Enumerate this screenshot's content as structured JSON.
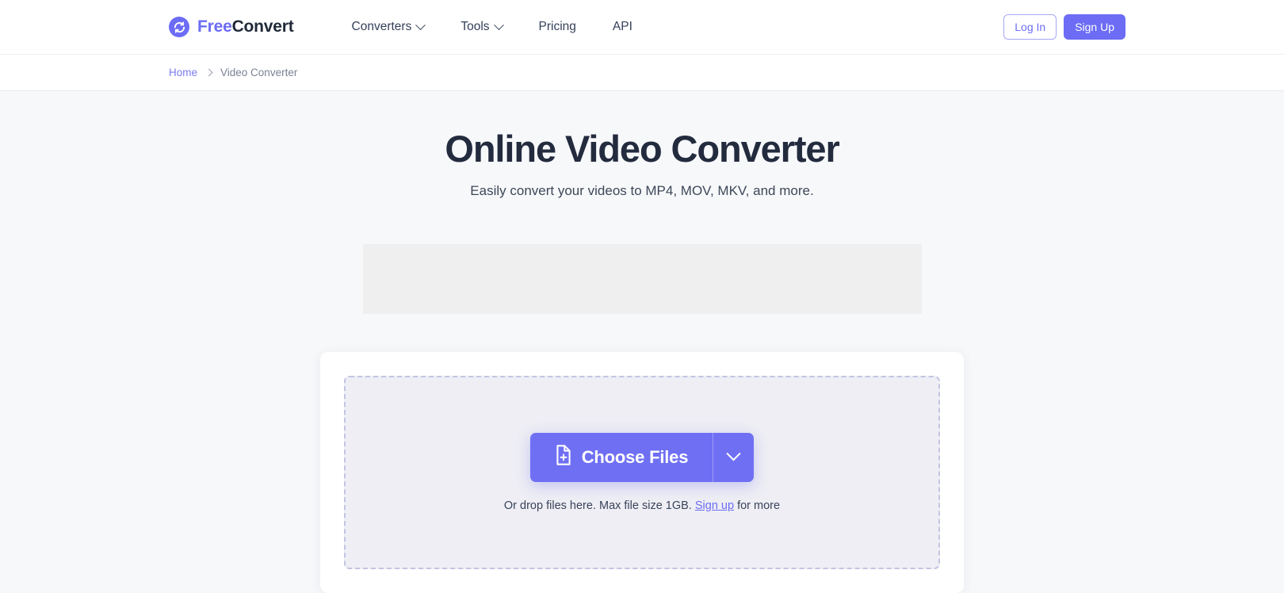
{
  "header": {
    "brand": {
      "icon": "sync-refresh-icon",
      "name_first": "Free",
      "name_second": "Convert"
    },
    "nav": [
      {
        "label": "Converters",
        "has_dropdown": true
      },
      {
        "label": "Tools",
        "has_dropdown": true
      },
      {
        "label": "Pricing",
        "has_dropdown": false
      },
      {
        "label": "API",
        "has_dropdown": false
      }
    ],
    "login_label": "Log In",
    "signup_label": "Sign Up"
  },
  "breadcrumb": {
    "home_label": "Home",
    "separator_icon": "chevron-right-icon",
    "current_label": "Video Converter"
  },
  "main": {
    "title": "Online Video Converter",
    "subtitle": "Easily convert your videos to MP4, MOV, MKV, and more.",
    "upload": {
      "choose_files_label": "Choose Files",
      "choose_files_icon": "file-plus-icon",
      "dropdown_icon": "chevron-down-icon",
      "hint_before": "Or drop files here. Max file size 1GB.",
      "hint_link": "Sign up",
      "hint_after": "for more"
    }
  },
  "colors": {
    "accent": "#6c6cf5",
    "accent_button": "#6f6ff4",
    "title": "#232b3e",
    "page_bg": "#f7f8fa",
    "dropzone_bg": "#eeeef4",
    "dropzone_border": "#c3c5e2",
    "ad_slot_bg": "#efefef"
  }
}
